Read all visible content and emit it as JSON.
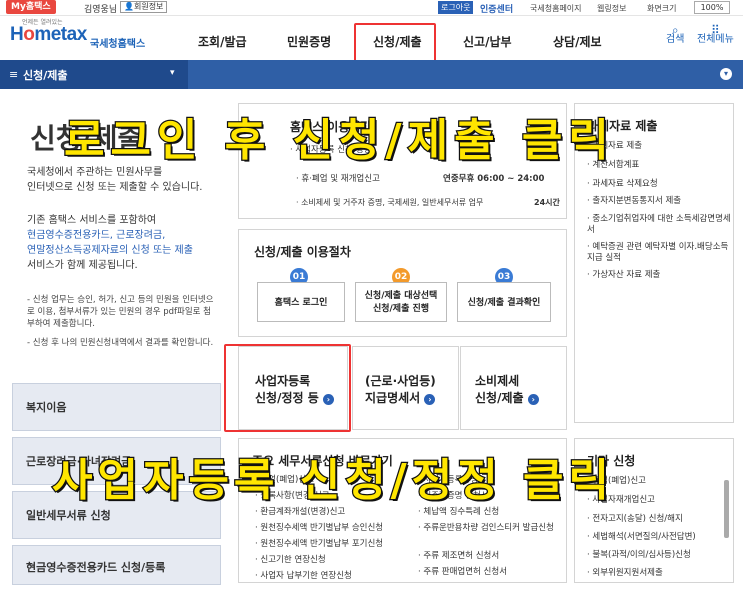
{
  "topbar": {
    "my_tag": "My홈택스",
    "username": "김영웅님",
    "member_info": "회원정보",
    "logout": "로그아웃",
    "cert_center": "인증센터",
    "util_links": [
      "국세청홈페이지",
      "웹링정보",
      "화면크기"
    ],
    "zoom": "100%"
  },
  "header": {
    "logo_sub": "언제든 열려있는",
    "logo_text": "국세청홈택스",
    "nav": [
      "조회/발급",
      "민원증명",
      "신청/제출",
      "신고/납부",
      "상담/제보"
    ],
    "search_label": "검색",
    "allmenu_label": "전체메뉴"
  },
  "section": {
    "menu_label": "신청/제출"
  },
  "left": {
    "title": "신청/제출",
    "intro": [
      "국세청에서 주관하는 민원사무를",
      "인터넷으로 신청 또는 제출할 수 있습니다."
    ],
    "desc_1": "기존 홈택스 서비스를 포함하여",
    "desc_blue": [
      "현금영수증전용카드, 근로장려금,",
      "연말정산소득공제자료의 신청 또는 제출"
    ],
    "desc_2": "서비스가 함께 제공됩니다.",
    "notes": [
      "- 신청 업무는 승인, 허가, 신고 등의 민원을 인터넷으",
      "  로 이용, 첨부서류가 있는 민원의 경우 pdf파일로 첨",
      "  부하여 제출합니다.",
      "- 신청 후 나의 민원신청내역에서 결과를 확인합니다."
    ],
    "buttons": [
      "복지이음",
      "근로장려금·자녀장려금",
      "일반세무서류 신청",
      "현금영수증전용카드 신청/등록"
    ]
  },
  "notice": {
    "title": "홈택스 이용시간",
    "line1": "· 사업자등록 신청/정정",
    "line2_label": "· 휴·폐업 및 재개업신고",
    "line2_time": "연중무휴 06:00 ~ 24:00",
    "line3_label": "· 소비제세 및 거주자 증명, 국제세원, 일반세무서류 업무",
    "line3_time": "24시간"
  },
  "process": {
    "title": "신청/제출 이용절차",
    "steps": [
      {
        "num": "01",
        "label": "홈택스 로그인",
        "color": "#3a7bd5"
      },
      {
        "num": "02",
        "label": "신청/제출 대상선택\n신청/제출 진행",
        "color": "#f39a2b"
      },
      {
        "num": "03",
        "label": "신청/제출 결과확인",
        "color": "#3a7bd5"
      }
    ]
  },
  "cards": [
    {
      "l1": "사업자등록",
      "l2": "신청/정정 등"
    },
    {
      "l1": "(근로·사업등)",
      "l2": "지급명세서"
    },
    {
      "l1": "소비제세",
      "l2": "신청/제출"
    }
  ],
  "docs": {
    "title": "주요 세무서류신청 바로가기",
    "col1": [
      "· 휴업(폐업)신고",
      "· 등록사항(변경)신고",
      "· 환급계좌개설(변경)신고",
      "· 원천징수세액 반기별납부 승인신청",
      "· 원천징수세액 반기별납부 포기신청",
      "· 신고기한 연장신청",
      "· 사업자 납부기한 연장신청"
    ],
    "col2": [
      "· 사업자등록증명",
      "· 거주자증명 신청서",
      "· 체납액 징수특례 신청",
      "· 주류운반용차량 검인스티커 발급신청",
      "· 주류 제조면허 신청서",
      "· 주류 판매업면허 신청서"
    ]
  },
  "right_top": {
    "title": "과세자료 제출",
    "items": [
      "· 과세자료 제출",
      "· 계산서합계표",
      "· 과세자료 삭제요청",
      "· 출자지분변동통지서 제출",
      "· 중소기업취업자에 대한 소득세감면명세서",
      "· 예탁증권 관련 예탁자별 이자.배당소득 지급 실적",
      "· 가상자산 자료 제출"
    ]
  },
  "right_bottom": {
    "title": "기타 신청",
    "items": [
      "· 휴업(폐업)신고",
      "· 사업자재개업신고",
      "· 전자고지(송달) 신청/해지",
      "· 세법해석(서면질의/사전답변)",
      "· 불복(과적/이의/심사등)신청",
      "· 외부위원지원서제출"
    ]
  },
  "overlays": {
    "top": "로그인 후 신청/제출 클릭",
    "bottom": "사업자등록 신청/정정 클릭"
  },
  "highlight_color": "#ee3333"
}
